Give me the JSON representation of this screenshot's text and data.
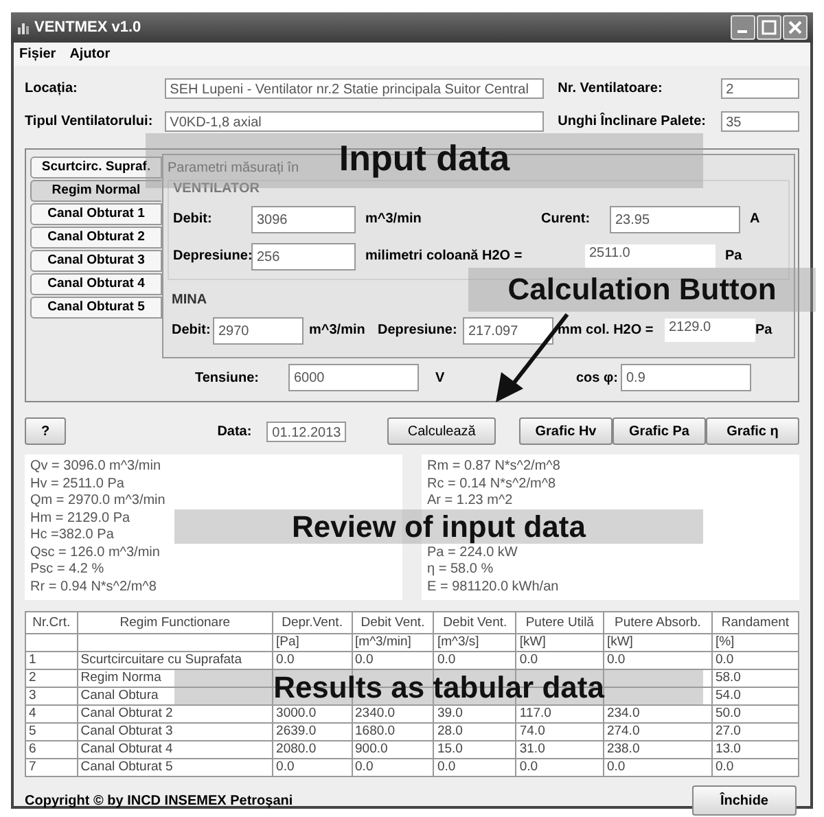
{
  "window": {
    "title": "VENTMEX v1.0"
  },
  "menu": [
    "Fișier",
    "Ajutor"
  ],
  "header": [
    {
      "label": "Locația:",
      "value": "SEH Lupeni - Ventilator nr.2 Statie principala Suitor Central",
      "side_label": "Nr. Ventilatoare:",
      "side_value": "2"
    },
    {
      "label": "Tipul Ventilatorului:",
      "value": "V0KD-1,8 axial",
      "side_label": "Unghi Înclinare Palete:",
      "side_value": "35"
    }
  ],
  "tabs": [
    {
      "label": "Scurtcirc. Supraf.",
      "selected": false
    },
    {
      "label": "Regim Normal",
      "selected": true
    },
    {
      "label": "Canal Obturat 1",
      "selected": false
    },
    {
      "label": "Canal Obturat 2",
      "selected": false
    },
    {
      "label": "Canal Obturat 3",
      "selected": false
    },
    {
      "label": "Canal Obturat 4",
      "selected": false
    },
    {
      "label": "Canal Obturat 5",
      "selected": false
    }
  ],
  "panel": {
    "title": "Parametri măsurați în",
    "fan": {
      "heading": "VENTILATOR",
      "flow_label": "Debit:",
      "flow": "3096",
      "flow_unit": "m^3/min",
      "current_label": "Curent:",
      "current": "23.95",
      "current_unit": "A",
      "depression_label": "Depresiune:",
      "depression": "256",
      "depression_unit": "milimetri coloană H2O =",
      "converted": "2511.0",
      "converted_unit": "Pa"
    },
    "mine": {
      "heading": "MINA",
      "flow_label": "Debit:",
      "flow": "2970",
      "flow_unit": "m^3/min",
      "depression_label": "Depresiune:",
      "depression": "217.097",
      "depression_unit": "mm col. H2O =",
      "converted": "2129.0",
      "converted_unit": "Pa"
    },
    "voltage_label": "Tensiune:",
    "voltage": "6000",
    "voltage_unit": "V",
    "cos_label": "cos φ:",
    "cos": "0.9"
  },
  "help_button": "?",
  "date_label": "Data:",
  "date": "01.12.2013",
  "calc_button": "Calculează",
  "chart_buttons": [
    "Grafic Hv",
    "Grafic Pa",
    "Grafic η"
  ],
  "review_left": [
    "Qv = 3096.0 m^3/min",
    "Hv = 2511.0 Pa",
    "Qm = 2970.0 m^3/min",
    "Hm = 2129.0 Pa",
    "Hc =382.0 Pa",
    "Qsc = 126.0 m^3/min",
    "Psc = 4.2 %",
    "Rr = 0.94 N*s^2/m^8"
  ],
  "review_right_top": [
    "Rm = 0.87 N*s^2/m^8",
    "Rc = 0.14 N*s^2/m^8",
    "Ar = 1.23 m^2"
  ],
  "review_right_bottom": [
    "Pa = 224.0 kW",
    "η = 58.0 %",
    "E = 981120.0 kWh/an"
  ],
  "table": {
    "columns": [
      {
        "title": "Nr.Crt."
      },
      {
        "title": "Regim Functionare"
      },
      {
        "title": "Depr.Vent.",
        "unit": "[Pa]"
      },
      {
        "title": "Debit Vent.",
        "unit": "[m^3/min]"
      },
      {
        "title": "Debit Vent.",
        "unit": "[m^3/s]"
      },
      {
        "title": "Putere Utilă",
        "unit": "[kW]"
      },
      {
        "title": "Putere Absorb.",
        "unit": "[kW]"
      },
      {
        "title": "Randament",
        "unit": "[%]"
      }
    ],
    "rows": [
      [
        "1",
        "Scurtcircuitare cu Suprafata",
        "0.0",
        "0.0",
        "0.0",
        "0.0",
        "0.0",
        "0.0"
      ],
      [
        "2",
        "Regim Norma",
        null,
        null,
        null,
        null,
        null,
        "58.0"
      ],
      [
        "3",
        "Canal Obtura",
        null,
        null,
        null,
        null,
        null,
        "54.0"
      ],
      [
        "4",
        "Canal Obturat 2",
        "3000.0",
        "2340.0",
        "39.0",
        "117.0",
        "234.0",
        "50.0"
      ],
      [
        "5",
        "Canal Obturat 3",
        "2639.0",
        "1680.0",
        "28.0",
        "74.0",
        "274.0",
        "27.0"
      ],
      [
        "6",
        "Canal Obturat 4",
        "2080.0",
        "900.0",
        "15.0",
        "31.0",
        "238.0",
        "13.0"
      ],
      [
        "7",
        "Canal Obturat 5",
        "0.0",
        "0.0",
        "0.0",
        "0.0",
        "0.0",
        "0.0"
      ]
    ]
  },
  "footer": {
    "copyright": "Copyright © by INCD INSEMEX Petroşani",
    "close_button": "Închide"
  },
  "annotations": [
    {
      "kind": "input",
      "text": "Input data"
    },
    {
      "kind": "button",
      "text": "Calculation Button"
    },
    {
      "kind": "review",
      "text": "Review of input data"
    },
    {
      "kind": "results",
      "text": "Results as tabular data"
    }
  ]
}
